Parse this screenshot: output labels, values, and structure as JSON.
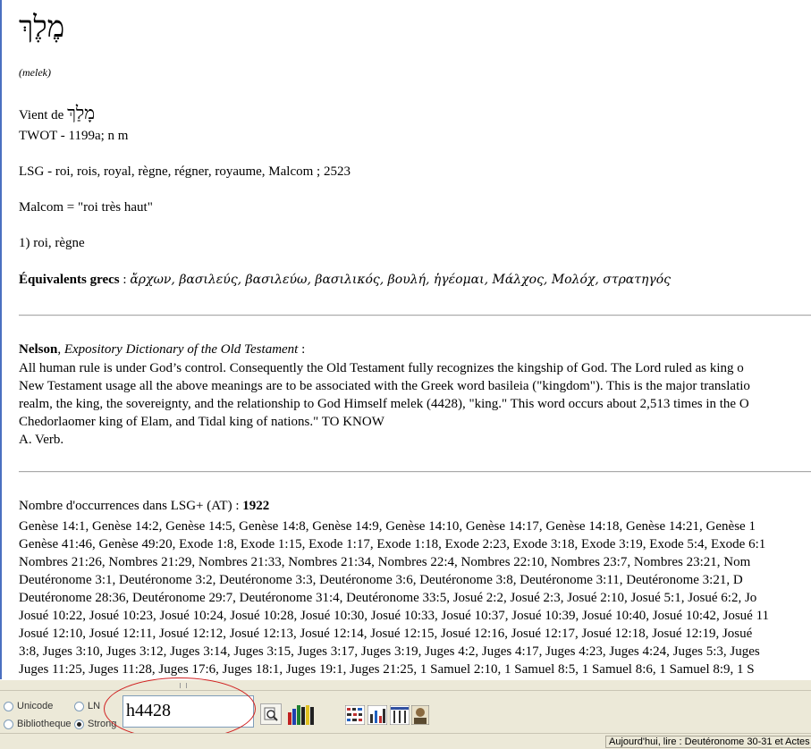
{
  "entry": {
    "hebrew": "מֶלֶךְ",
    "transliteration": "(melek)",
    "from_label": "Vient de",
    "from_hebrew": "מָלַךְ",
    "twot": "TWOT - 1199a; n m",
    "lsg": "LSG - roi, rois, royal, règne, régner, royaume, Malcom ; 2523",
    "malcom": "Malcom = \"roi très haut\"",
    "meaning": "1) roi, règne",
    "greek_label": "Équivalents grecs",
    "greek_sep": " : ",
    "greek_words": "ἄρχων, βασιλεύς, βασιλεύω, βασιλικός, βουλή, ἡγέομαι, Μάλχος, Μολόχ, στρατηγός"
  },
  "nelson": {
    "author": "Nelson",
    "sep": ", ",
    "book": "Expository Dictionary of the Old Testament",
    "colon": " :",
    "lines": [
      "All human rule is under God’s control. Consequently the Old Testament fully recognizes the kingship of God. The Lord ruled as king o",
      "New Testament usage all the above meanings are to be associated with the Greek word basileia (\"kingdom\"). This is the major translatio",
      "realm, the king, the sovereignty, and the relationship to God Himself melek (4428), \"king.\" This word occurs about 2,513 times in the O",
      "Chedorlaomer king of Elam, and Tidal king of nations.\" TO KNOW",
      "A. Verb."
    ]
  },
  "occurrences": {
    "label": "Nombre d'occurrences dans LSG+ (AT) : ",
    "count": "1922",
    "lines": [
      "Genèse 14:1, Genèse 14:2, Genèse 14:5, Genèse 14:8, Genèse 14:9, Genèse 14:10, Genèse 14:17, Genèse 14:18, Genèse 14:21, Genèse 1",
      "Genèse 41:46, Genèse 49:20, Exode 1:8, Exode 1:15, Exode 1:17, Exode 1:18, Exode 2:23, Exode 3:18, Exode 3:19, Exode 5:4, Exode 6:1",
      "Nombres 21:26, Nombres 21:29, Nombres 21:33, Nombres 21:34, Nombres 22:4, Nombres 22:10, Nombres 23:7, Nombres 23:21, Nom",
      "Deutéronome 3:1, Deutéronome 3:2, Deutéronome 3:3, Deutéronome 3:6, Deutéronome 3:8, Deutéronome 3:11, Deutéronome 3:21, D",
      "Deutéronome 28:36, Deutéronome 29:7, Deutéronome 31:4, Deutéronome 33:5, Josué 2:2, Josué 2:3, Josué 2:10, Josué 5:1, Josué 6:2, Jo",
      "Josué 10:22, Josué 10:23, Josué 10:24, Josué 10:28, Josué 10:30, Josué 10:33, Josué 10:37, Josué 10:39, Josué 10:40, Josué 10:42, Josué 11",
      "Josué 12:10, Josué 12:11, Josué 12:12, Josué 12:13, Josué 12:14, Josué 12:15, Josué 12:16, Josué 12:17, Josué 12:18, Josué 12:19, Josué",
      "3:8, Juges 3:10, Juges 3:12, Juges 3:14, Juges 3:15, Juges 3:17, Juges 3:19, Juges 4:2, Juges 4:17, Juges 4:23, Juges 4:24, Juges 5:3, Juges",
      "Juges 11:25, Juges 11:28, Juges 17:6, Juges 18:1, Juges 19:1, Juges 21:25, 1 Samuel 2:10, 1 Samuel 8:5, 1 Samuel 8:6, 1 Samuel 8:9, 1 S"
    ]
  },
  "toolbar": {
    "radio_unicode": "Unicode",
    "radio_ln": "LN",
    "radio_bibliotheque": "Bibliotheque",
    "radio_strong": "Strong",
    "selected": "Strong",
    "search_value": "h4428"
  },
  "status": {
    "reading": "Aujourd'hui, lire : Deutéronome 30-31 et Actes 2"
  }
}
